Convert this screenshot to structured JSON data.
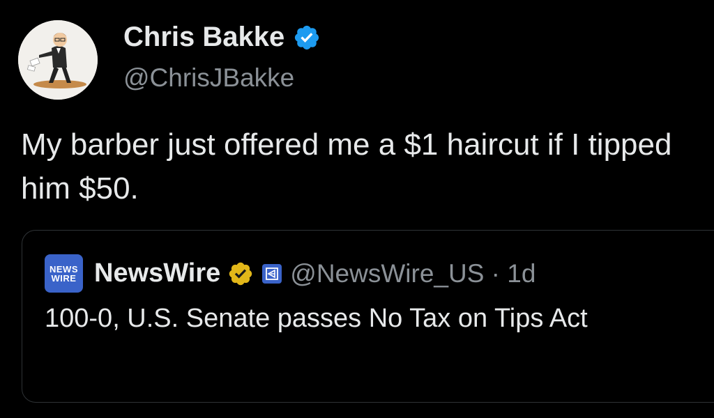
{
  "tweet": {
    "author": {
      "name": "Chris Bakke",
      "handle": "@ChrisJBakke",
      "avatar_icon": "bitmoji-avatar",
      "verified_icon": "blue-verified-badge-icon",
      "verified_color": "#1d9bf0"
    },
    "text": "My barber just offered me a $1 haircut if I tipped him $50.",
    "quote": {
      "logo_line1": "NEWS",
      "logo_line2": "WIRE",
      "name": "NewsWire",
      "verified_icon": "gold-verified-badge-icon",
      "verified_color": "#e2b719",
      "affiliate_icon": "affiliate-badge-icon",
      "meta": "@NewsWire_US · 1d",
      "text": "100-0, U.S. Senate passes No Tax on Tips Act"
    }
  }
}
